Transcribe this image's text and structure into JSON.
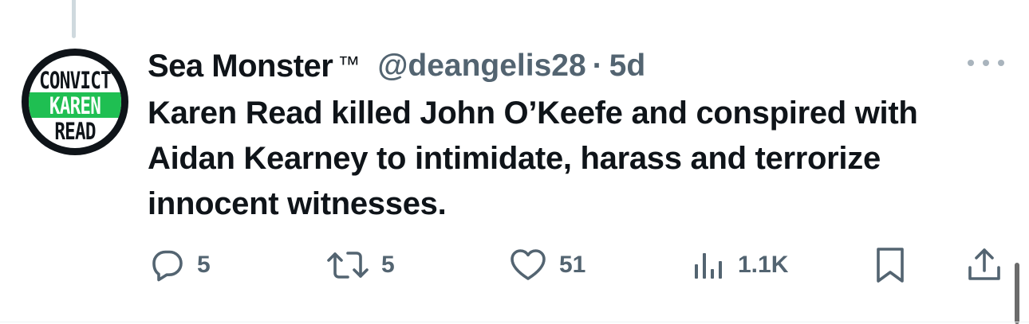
{
  "tweet": {
    "avatar": {
      "line1": "CONVICT",
      "line2": "KAREN",
      "line3": "READ",
      "colors": {
        "ring": "#0f1419",
        "band": "#1fbf52"
      }
    },
    "display_name": "Sea Monster",
    "badge": "™",
    "handle": "@deangelis28",
    "separator": "·",
    "time": "5d",
    "text": "Karen Read killed John O’Keefe and conspired with Aidan Kearney to intimidate, harass and terrorize innocent witnesses.",
    "actions": {
      "replies": "5",
      "retweets": "5",
      "likes": "51",
      "views": "1.1K"
    },
    "icons": [
      "more-icon",
      "reply-icon",
      "retweet-icon",
      "like-icon",
      "views-icon",
      "bookmark-icon",
      "share-icon"
    ],
    "colors": {
      "text": "#0f1419",
      "secondary": "#536471"
    }
  }
}
